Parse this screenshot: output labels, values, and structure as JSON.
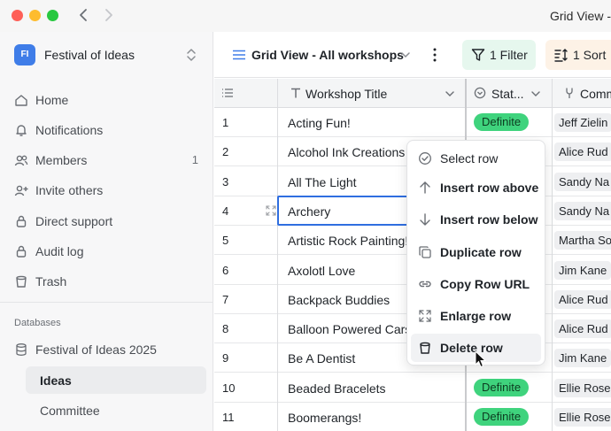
{
  "window": {
    "title": "Grid View -"
  },
  "workspace": {
    "initials": "FI",
    "name": "Festival of Ideas"
  },
  "sidebar": {
    "items": [
      {
        "label": "Home",
        "icon": "home-icon",
        "count": ""
      },
      {
        "label": "Notifications",
        "icon": "bell-icon",
        "count": ""
      },
      {
        "label": "Members",
        "icon": "users-icon",
        "count": "1"
      },
      {
        "label": "Invite others",
        "icon": "user-plus-icon",
        "count": ""
      },
      {
        "label": "Direct support",
        "icon": "lock-icon",
        "count": ""
      },
      {
        "label": "Audit log",
        "icon": "lock-icon",
        "count": ""
      },
      {
        "label": "Trash",
        "icon": "trash-icon",
        "count": ""
      }
    ],
    "section_label": "Databases",
    "database": {
      "label": "Festival of Ideas 2025",
      "icon": "database-icon"
    },
    "tables": [
      {
        "label": "Ideas",
        "active": true
      },
      {
        "label": "Committee",
        "active": false
      }
    ]
  },
  "toolbar": {
    "view_name": "Grid View - All workshops",
    "filter_label": "1 Filter",
    "sort_label": "1 Sort"
  },
  "grid": {
    "columns": [
      {
        "label": "",
        "icon": "row-list-icon"
      },
      {
        "label": "Workshop Title",
        "icon": "text-field-icon"
      },
      {
        "label": "Stat...",
        "icon": "status-icon"
      },
      {
        "label": "Comm",
        "icon": "link-field-icon"
      }
    ],
    "rows": [
      {
        "num": "1",
        "title": "Acting Fun!",
        "status": "Definite",
        "comm": "Jeff Zielin"
      },
      {
        "num": "2",
        "title": "Alcohol Ink Creations",
        "status": "",
        "comm": "Alice Rud"
      },
      {
        "num": "3",
        "title": "All The Light",
        "status": "",
        "comm": "Sandy Na"
      },
      {
        "num": "4",
        "title": "Archery",
        "status": "",
        "comm": "Sandy Na"
      },
      {
        "num": "5",
        "title": "Artistic Rock Painting!",
        "status": "",
        "comm": "Martha So"
      },
      {
        "num": "6",
        "title": "Axolotl Love",
        "status": "",
        "comm": "Jim Kane"
      },
      {
        "num": "7",
        "title": "Backpack Buddies",
        "status": "",
        "comm": "Alice Rud"
      },
      {
        "num": "8",
        "title": "Balloon Powered Cars",
        "status": "",
        "comm": "Alice Rud"
      },
      {
        "num": "9",
        "title": "Be A Dentist",
        "status": "",
        "comm": "Jim Kane"
      },
      {
        "num": "10",
        "title": "Beaded Bracelets",
        "status": "Definite",
        "comm": "Ellie Rose"
      },
      {
        "num": "11",
        "title": "Boomerangs!",
        "status": "Definite",
        "comm": "Ellie Rose"
      }
    ]
  },
  "context_menu": {
    "items": [
      {
        "label": "Select row",
        "icon": "check-circle-icon"
      },
      {
        "label": "Insert row above",
        "icon": "arrow-up-icon"
      },
      {
        "label": "Insert row below",
        "icon": "arrow-down-icon"
      },
      {
        "label": "Duplicate row",
        "icon": "copy-icon"
      },
      {
        "label": "Copy Row URL",
        "icon": "link-icon"
      },
      {
        "label": "Enlarge row",
        "icon": "expand-icon"
      },
      {
        "label": "Delete row",
        "icon": "trash-icon"
      }
    ]
  },
  "colors": {
    "status_green": "#3fd37d",
    "filter_bg": "#e6f7ee",
    "sort_bg": "#fdf2e6",
    "focus_blue": "#2f6ee0",
    "workspace_badge": "#3f7de8"
  }
}
